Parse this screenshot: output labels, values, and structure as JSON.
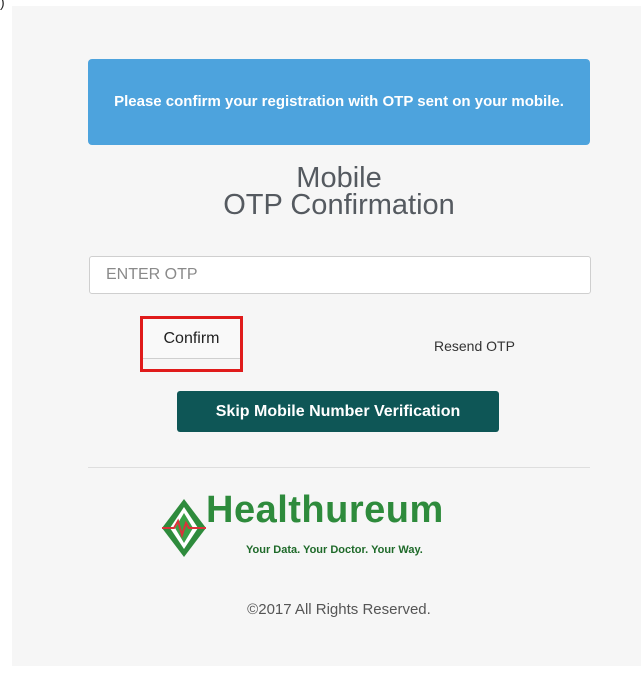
{
  "top_glyph": ")",
  "alert": {
    "message": "Please confirm your registration with OTP sent on your mobile."
  },
  "heading": {
    "line1": "Mobile",
    "line2": "OTP Confirmation"
  },
  "otp_field": {
    "placeholder": "ENTER OTP",
    "value": ""
  },
  "buttons": {
    "confirm_label": "Confirm",
    "resend_label": "Resend OTP",
    "skip_label": "Skip Mobile Number Verification"
  },
  "logo": {
    "wordmark": "Healthureum",
    "tagline": "Your Data. Your Doctor. Your Way."
  },
  "footer": {
    "copyright": "©2017 All Rights Reserved."
  },
  "colors": {
    "alert_bg": "#4da3dd",
    "skip_button_bg": "#0e5656",
    "highlight_border": "#e01b1b",
    "brand_green": "#2e8b3c"
  }
}
